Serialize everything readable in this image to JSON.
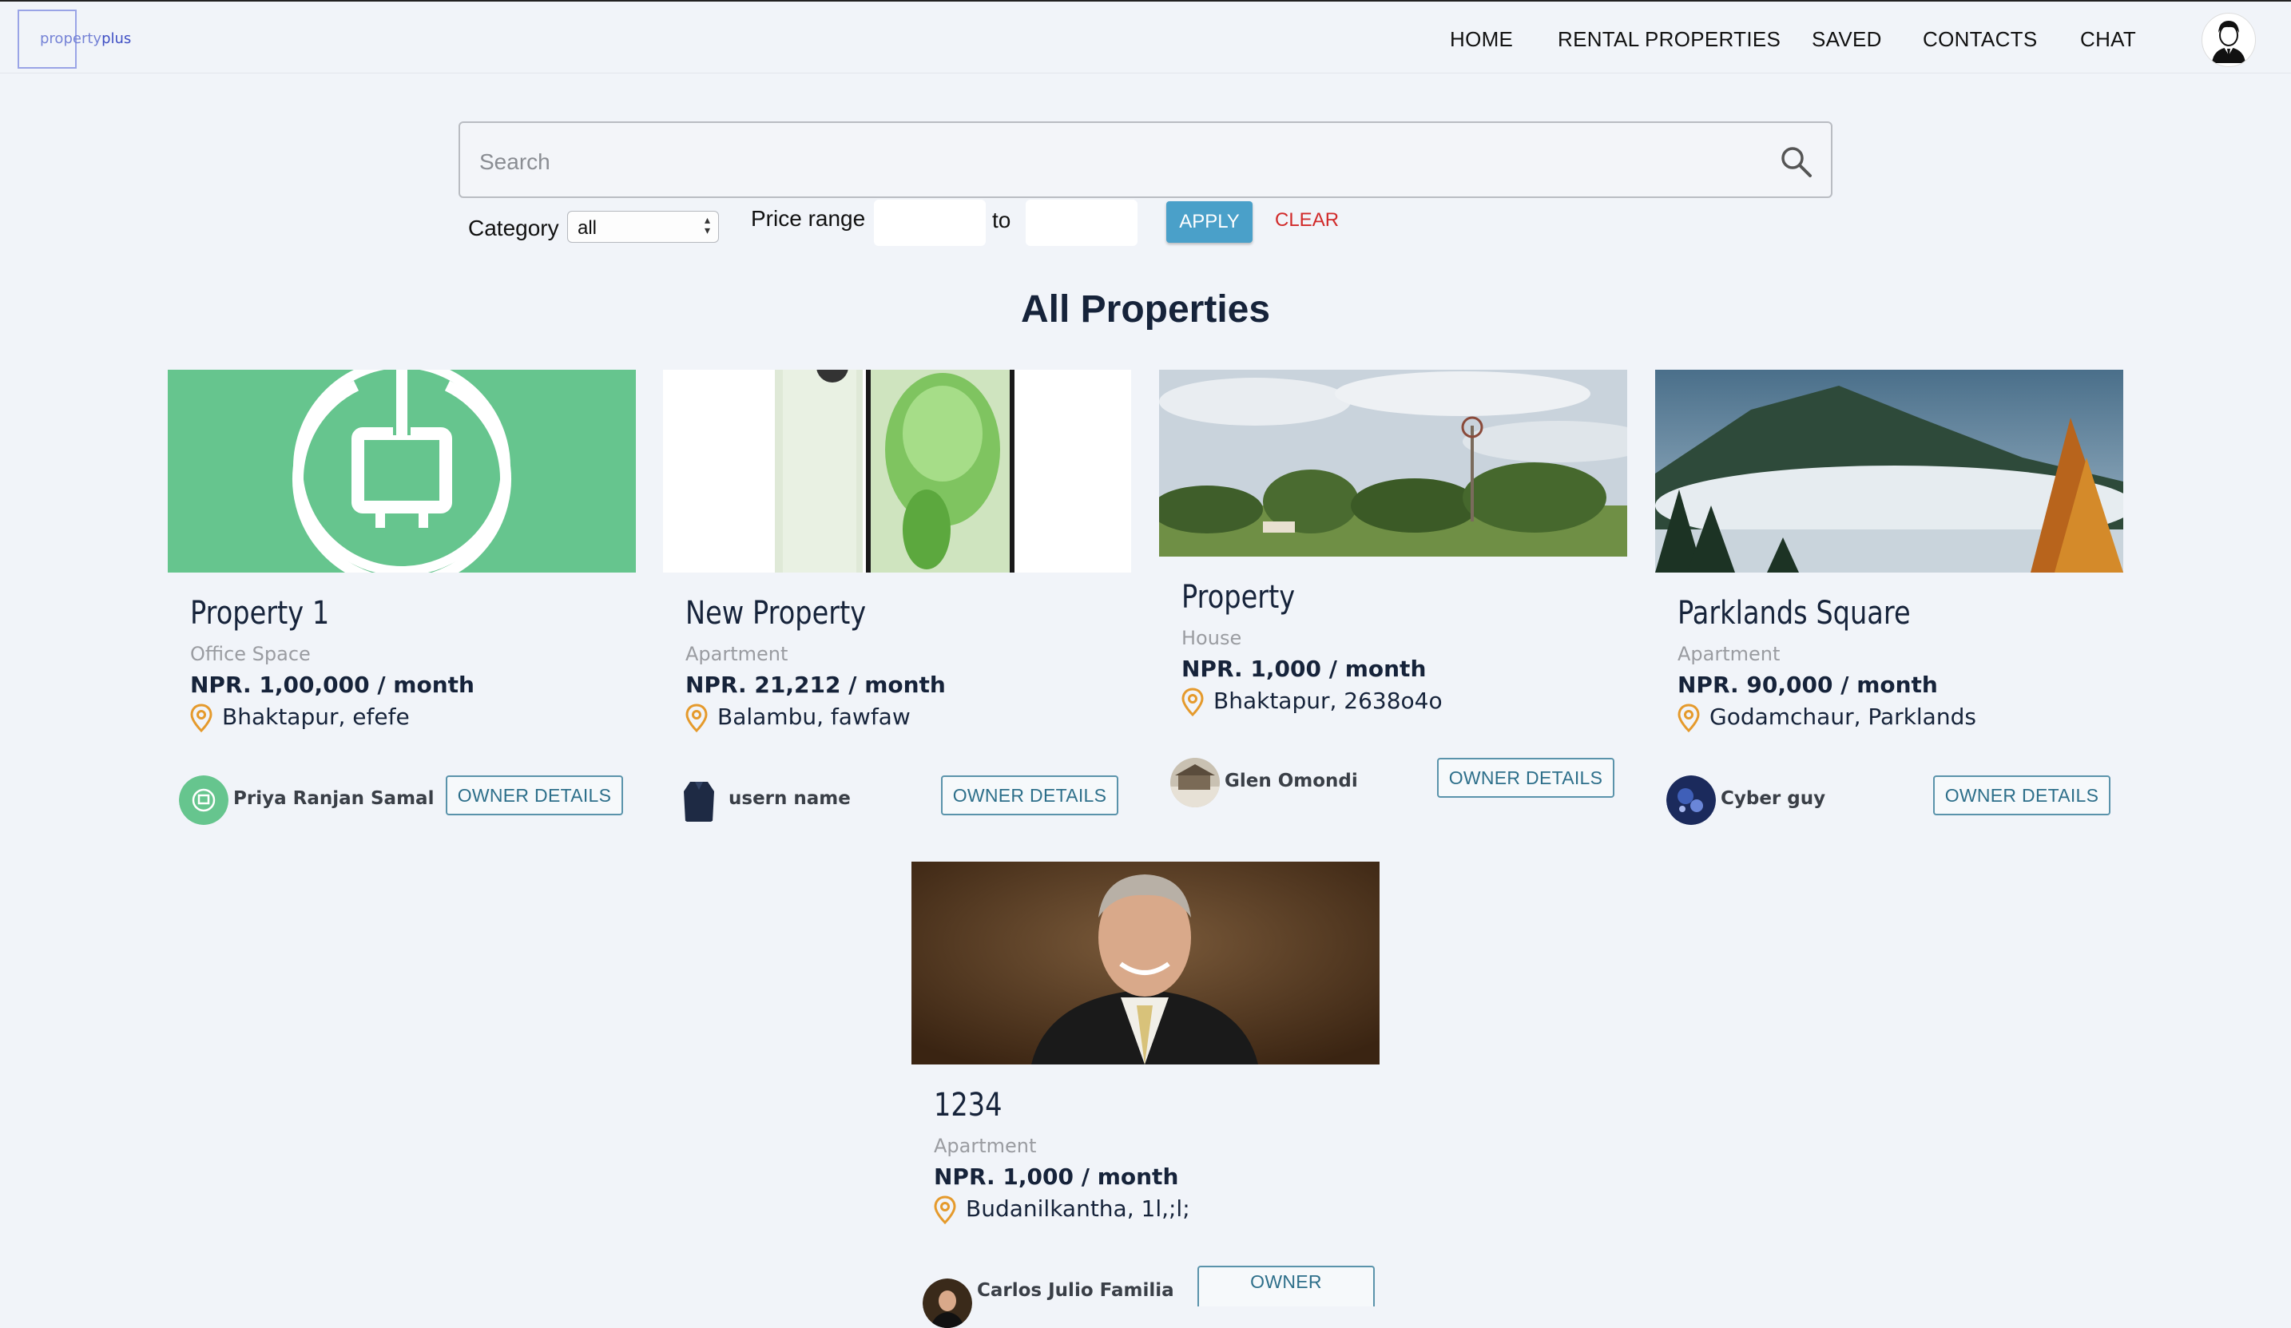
{
  "brand": {
    "name_part1": "property",
    "name_part2": "plus"
  },
  "nav": {
    "items": [
      {
        "label": "HOME"
      },
      {
        "label": "RENTAL PROPERTIES"
      },
      {
        "label": "SAVED"
      },
      {
        "label": "CONTACTS"
      },
      {
        "label": "CHAT"
      }
    ]
  },
  "search": {
    "placeholder": "Search",
    "value": ""
  },
  "filters": {
    "category_label": "Category",
    "category_value": "all",
    "price_label": "Price range",
    "to_label": "to",
    "apply_label": "APPLY",
    "clear_label": "CLEAR"
  },
  "page_title": "All Properties",
  "owner_button_label": "OWNER DETAILS",
  "owner_button_label_short": "OWNER",
  "properties": [
    {
      "title": "Property 1",
      "category": "Office Space",
      "price": "NPR. 1,00,000 / month",
      "location": "Bhaktapur, efefe",
      "owner": "Priya Ranjan Samal"
    },
    {
      "title": "New Property",
      "category": "Apartment",
      "price": "NPR. 21,212 / month",
      "location": "Balambu, fawfaw",
      "owner": "usern name"
    },
    {
      "title": "Property",
      "category": "House",
      "price": "NPR. 1,000 / month",
      "location": "Bhaktapur, 2638o4o",
      "owner": "Glen Omondi"
    },
    {
      "title": "Parklands Square",
      "category": "Apartment",
      "price": "NPR. 90,000 / month",
      "location": "Godamchaur, Parklands",
      "owner": "Cyber guy"
    },
    {
      "title": "1234",
      "category": "Apartment",
      "price": "NPR. 1,000 / month",
      "location": "Budanilkantha, 1l,;l;",
      "owner": "Carlos Julio Familia"
    }
  ],
  "colors": {
    "accent": "#4aa0c9",
    "clear": "#d12a2a",
    "pin": "#e59a2c",
    "title": "#16233a"
  }
}
